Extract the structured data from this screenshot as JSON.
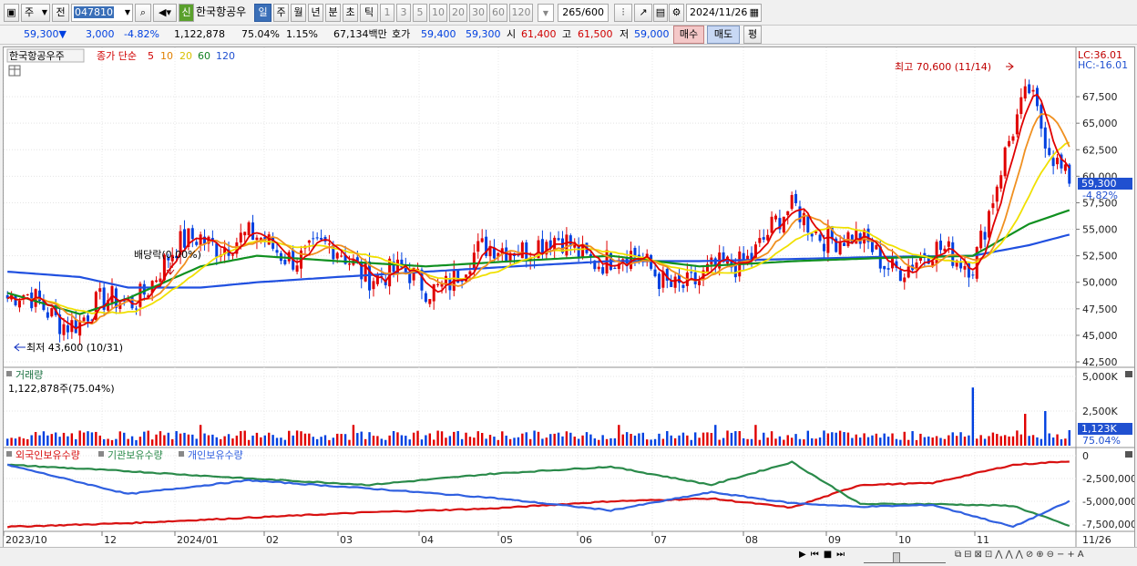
{
  "toolbar": {
    "period_unit": "주",
    "prev_label": "전",
    "code": "047810",
    "new_badge": "신",
    "stock_name": "한국항공우",
    "periods": [
      "일",
      "주",
      "월",
      "년",
      "분",
      "초",
      "틱"
    ],
    "selected_period": "일",
    "intervals": [
      "1",
      "3",
      "5",
      "10",
      "20",
      "30",
      "60",
      "120"
    ],
    "count": "265",
    "count_total": "/600",
    "date": "2024/11/26"
  },
  "quote": {
    "price": "59,300",
    "change": "3,000",
    "change_pct": "-4.82%",
    "volume": "1,122,878",
    "vol_ratio": "75.04%",
    "turnover": "1.15%",
    "amount": "67,134백만",
    "bid_label": "호가",
    "bid1": "59,400",
    "bid2": "59,300",
    "open_label": "시",
    "open": "61,400",
    "high_label": "고",
    "high": "61,500",
    "low_label": "저",
    "low": "59,000",
    "buy_label": "매수",
    "sell_label": "매도",
    "eval_label": "평"
  },
  "legend": {
    "name": "한국항공우주",
    "price_ma": "종가 단순",
    "periods": [
      "5",
      "10",
      "20",
      "60",
      "120"
    ]
  },
  "price_panel": {
    "y_labels": [
      "67,500",
      "65,000",
      "62,500",
      "60,000",
      "57,500",
      "55,000",
      "52,500",
      "50,000",
      "47,500",
      "45,000",
      "42,500"
    ],
    "lc": "LC:36.01",
    "hc": "HC:-16.01",
    "last_price": "59,300",
    "last_pct": "-4.82%",
    "high_annotation": "최고 70,600 (11/14)",
    "low_annotation": "최저 43,600 (10/31)",
    "dividend_annotation": "배당락(0.00%)"
  },
  "volume_panel": {
    "title": "거래량",
    "value": "1,122,878주(75.04%)",
    "y_labels": [
      "5,000K",
      "2,500K"
    ],
    "last": "1,123K",
    "last_pct": "75.04%"
  },
  "holding_panel": {
    "legends": [
      "외국인보유수량",
      "기관보유수량",
      "개인보유수량"
    ],
    "y_labels": [
      "0",
      "-2,500,000",
      "-5,000,000",
      "-7,500,000"
    ]
  },
  "x_axis": [
    "2023/10",
    "12",
    "2024/01",
    "02",
    "03",
    "04",
    "05",
    "06",
    "07",
    "08",
    "09",
    "10",
    "11",
    "11/26"
  ],
  "colors": {
    "ma5": "#e00000",
    "ma10": "#f09020",
    "ma20": "#f0e000",
    "ma60": "#109020",
    "ma120": "#2050e0",
    "up": "#e00000",
    "down": "#0040e0",
    "foreign": "#d81010",
    "institution": "#2a8a4a",
    "individual": "#3060e0"
  },
  "chart_data": {
    "type": "candlestick",
    "ma_days": [
      5,
      10,
      20,
      60,
      120
    ],
    "anchors_date": [
      "2023-10",
      "2023-12",
      "2024-01",
      "2024-02",
      "2024-03",
      "2024-04",
      "2024-05",
      "2024-06",
      "2024-07",
      "2024-08",
      "2024-09",
      "2024-10",
      "2024-11",
      "2024-11-26"
    ],
    "close_approx": [
      48500,
      46500,
      48500,
      54500,
      53500,
      52500,
      49500,
      54000,
      52500,
      49500,
      56500,
      52000,
      52500,
      68000,
      59300
    ],
    "ma60_approx": [
      49000,
      47000,
      48500,
      51500,
      52500,
      52000,
      51500,
      52000,
      52500,
      51500,
      52000,
      52300,
      52500,
      55500,
      56800
    ],
    "ma120_approx": [
      51000,
      50500,
      49500,
      49500,
      50000,
      50500,
      51000,
      51500,
      52000,
      52000,
      52200,
      52400,
      52500,
      53500,
      54500
    ],
    "high": {
      "value": 70600,
      "date": "11/14"
    },
    "low": {
      "value": 43600,
      "date": "10/31"
    },
    "ylim": [
      42500,
      70000
    ],
    "volume_ylim": [
      0,
      5000
    ],
    "holding_ylim": [
      -8000000,
      0
    ]
  }
}
